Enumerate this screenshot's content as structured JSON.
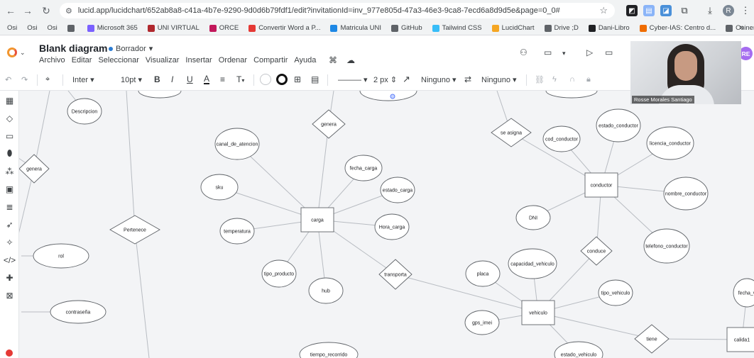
{
  "browser": {
    "url": "lucid.app/lucidchart/652ab8a8-c41a-4b7e-9290-9d0d6b79fdf1/edit?invitationId=inv_977e805d-47a3-46e3-9ca8-7ecd6a8d9d5e&page=0_0#",
    "profile_initial": "R",
    "bookmarks": [
      "Osi",
      "Osi",
      "Osi",
      "",
      "Microsoft 365",
      "UNI VIRTUAL",
      "ORCE",
      "Convertir Word a P...",
      "Matricula UNI",
      "GitHub",
      "Tailwind CSS",
      "LucidChart",
      "Drive ;D",
      "Dani-Libro",
      "Cyber-IAS: Centro d...",
      "Osinergmin"
    ],
    "bookmark_colors": [
      "#5f6368",
      "#5f6368",
      "#5f6368",
      "#5f6368",
      "#7b61ff",
      "#b0282e",
      "#c2185b",
      "#e53935",
      "#1e88e5",
      "#5f6368",
      "#38bdf8",
      "#f5a623",
      "#5f6368",
      "#202124",
      "#ef6c00",
      "#5f6368"
    ],
    "more_bookmarks": "»"
  },
  "app": {
    "title": "Blank diagram",
    "status": "Borrador",
    "menus": [
      "Archivo",
      "Editar",
      "Seleccionar",
      "Visualizar",
      "Insertar",
      "Ordenar",
      "Compartir",
      "Ayuda"
    ],
    "avatar_initials": "RE"
  },
  "toolbar": {
    "font": "Inter",
    "font_size": "10pt",
    "bold": "B",
    "italic": "I",
    "underline": "U",
    "text_color": "A",
    "align": "≡",
    "text_options": "T",
    "line_width": "2 px",
    "start_arrow": "Ninguno",
    "end_arrow": "Ninguno"
  },
  "camera": {
    "participant": "Rosse Morales Santiago"
  },
  "diagram": {
    "entities": [
      {
        "id": "carga",
        "label": "carga"
      },
      {
        "id": "conductor",
        "label": "conductor"
      },
      {
        "id": "vehiculo",
        "label": "vehiculo"
      },
      {
        "id": "calida",
        "label": "calida1"
      }
    ],
    "relationships": [
      {
        "id": "genera1",
        "label": "genera"
      },
      {
        "id": "genera2",
        "label": "genera"
      },
      {
        "id": "pertenece",
        "label": "Pertenece"
      },
      {
        "id": "seasigna",
        "label": "se asigna"
      },
      {
        "id": "transporta",
        "label": "transporta"
      },
      {
        "id": "conduce",
        "label": "conduce"
      },
      {
        "id": "tiene",
        "label": "tiene"
      }
    ],
    "attributes": [
      {
        "id": "descripcion",
        "label": "Descripcion"
      },
      {
        "id": "rol",
        "label": "rol"
      },
      {
        "id": "contrasena",
        "label": "contraseña"
      },
      {
        "id": "canal",
        "label": "canal_de_atencion"
      },
      {
        "id": "sku",
        "label": "sku"
      },
      {
        "id": "temperatura",
        "label": "temperatura"
      },
      {
        "id": "tipo_producto",
        "label": "tipo_producto"
      },
      {
        "id": "hub",
        "label": "hub"
      },
      {
        "id": "fecha_carga",
        "label": "fecha_carga"
      },
      {
        "id": "estado_carga",
        "label": "estado_carga"
      },
      {
        "id": "hora_carga",
        "label": "Hora_carga"
      },
      {
        "id": "cod_conductor",
        "label": "cod_conductor"
      },
      {
        "id": "estado_conductor",
        "label": "estado_conductor"
      },
      {
        "id": "licencia_conductor",
        "label": "licencia_conductor"
      },
      {
        "id": "nombre_conductor",
        "label": "nombre_conductor"
      },
      {
        "id": "telefono_conductor",
        "label": "telefono_conductor"
      },
      {
        "id": "dni",
        "label": "DNI"
      },
      {
        "id": "placa",
        "label": "placa"
      },
      {
        "id": "capacidad_vehiculo",
        "label": "capacidad_vehiculo"
      },
      {
        "id": "tipo_vehiculo",
        "label": "tipo_vehiculo"
      },
      {
        "id": "gps_imei",
        "label": "gps_imei"
      },
      {
        "id": "estado_vehiculo",
        "label": "estado_vehiculo"
      },
      {
        "id": "tiempo_recorrido",
        "label": "tiempo_recorrido"
      },
      {
        "id": "fecha_v",
        "label": "fecha_v"
      }
    ]
  }
}
